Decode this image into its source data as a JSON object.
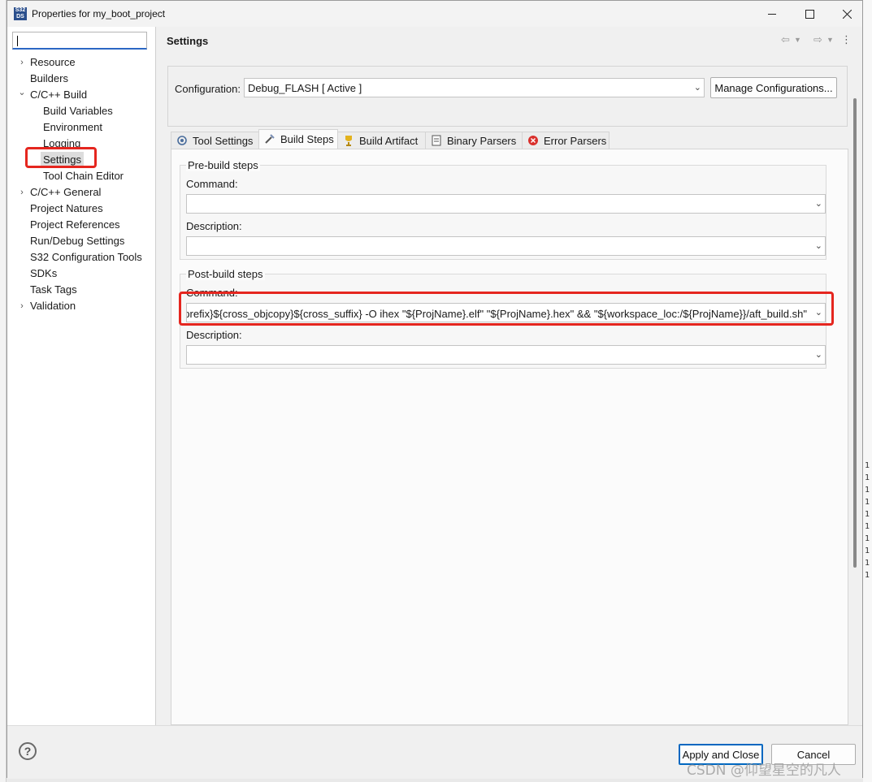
{
  "window": {
    "title": "Properties for my_boot_project",
    "app_icon_text": "S32\nDS"
  },
  "filter": {
    "value": ""
  },
  "tree": [
    {
      "label": "Resource",
      "expandable": true,
      "expanded": false,
      "level": 0
    },
    {
      "label": "Builders",
      "expandable": false,
      "level": 0
    },
    {
      "label": "C/C++ Build",
      "expandable": true,
      "expanded": true,
      "level": 0
    },
    {
      "label": "Build Variables",
      "level": 1
    },
    {
      "label": "Environment",
      "level": 1
    },
    {
      "label": "Logging",
      "level": 1
    },
    {
      "label": "Settings",
      "level": 1,
      "selected": true
    },
    {
      "label": "Tool Chain Editor",
      "level": 1
    },
    {
      "label": "C/C++ General",
      "expandable": true,
      "expanded": false,
      "level": 0
    },
    {
      "label": "Project Natures",
      "level": 0
    },
    {
      "label": "Project References",
      "level": 0
    },
    {
      "label": "Run/Debug Settings",
      "level": 0
    },
    {
      "label": "S32 Configuration Tools",
      "level": 0
    },
    {
      "label": "SDKs",
      "level": 0
    },
    {
      "label": "Task Tags",
      "level": 0
    },
    {
      "label": "Validation",
      "expandable": true,
      "expanded": false,
      "level": 0
    }
  ],
  "page": {
    "title": "Settings"
  },
  "configuration": {
    "label": "Configuration:",
    "value": "Debug_FLASH  [ Active ]",
    "manage_label": "Manage Configurations..."
  },
  "tabs": [
    {
      "label": "Tool Settings",
      "icon": "tool-settings-icon",
      "active": false
    },
    {
      "label": "Build Steps",
      "icon": "build-steps-icon",
      "active": true
    },
    {
      "label": "Build Artifact",
      "icon": "trophy-icon",
      "active": false
    },
    {
      "label": "Binary Parsers",
      "icon": "binary-parser-icon",
      "active": false
    },
    {
      "label": "Error Parsers",
      "icon": "error-icon",
      "active": false
    }
  ],
  "pre_build": {
    "title": "Pre-build steps",
    "command_label": "Command:",
    "command_value": "",
    "description_label": "Description:",
    "description_value": ""
  },
  "post_build": {
    "title": "Post-build steps",
    "command_label": "Command:",
    "command_value": "prefix}${cross_objcopy}${cross_suffix} -O ihex \"${ProjName}.elf\" \"${ProjName}.hex\" && \"${workspace_loc:/${ProjName}}/aft_build.sh\"",
    "description_label": "Description:",
    "description_value": ""
  },
  "footer": {
    "help": "?",
    "apply_close_label": "Apply and Close",
    "cancel_label": "Cancel"
  },
  "watermark": "CSDN @仰望星空的凡人",
  "colors": {
    "highlight": "#e5261f",
    "accent": "#0067c0"
  }
}
